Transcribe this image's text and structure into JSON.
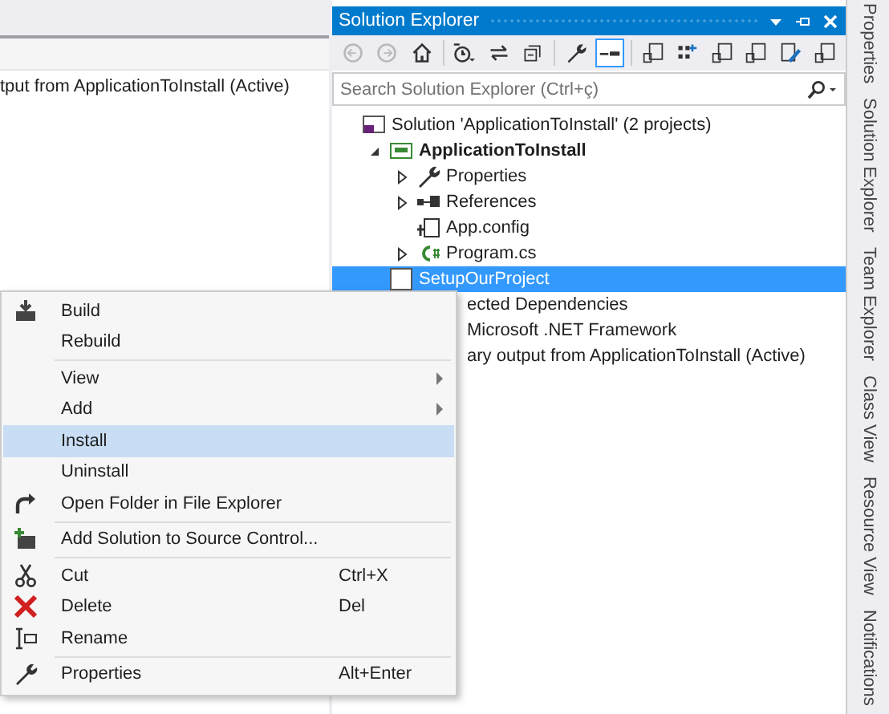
{
  "output_pane": {
    "line": "tput from ApplicationToInstall (Active)"
  },
  "solution_explorer": {
    "title": "Solution Explorer",
    "toolbar": [
      {
        "kind": "back",
        "disabled": true,
        "selected": false
      },
      {
        "kind": "forward",
        "disabled": true,
        "selected": false
      },
      {
        "kind": "home",
        "disabled": false,
        "selected": false
      },
      {
        "kind": "history",
        "disabled": false,
        "selected": false
      },
      {
        "kind": "sync",
        "disabled": false,
        "selected": false
      },
      {
        "kind": "collapse",
        "disabled": false,
        "selected": false
      },
      {
        "kind": "wrench",
        "disabled": false,
        "selected": false
      },
      {
        "kind": "pending",
        "disabled": false,
        "selected": true
      },
      {
        "kind": "file",
        "disabled": false,
        "selected": false
      },
      {
        "kind": "grid",
        "disabled": false,
        "selected": false
      },
      {
        "kind": "file",
        "disabled": false,
        "selected": false
      },
      {
        "kind": "file",
        "disabled": false,
        "selected": false
      },
      {
        "kind": "edit",
        "disabled": false,
        "selected": false
      },
      {
        "kind": "file",
        "disabled": false,
        "selected": false
      }
    ],
    "search": {
      "placeholder": "Search Solution Explorer (Ctrl+ç)"
    },
    "tree": [
      {
        "label": "Solution 'ApplicationToInstall' (2 projects)",
        "kind": "solution",
        "selected": false,
        "bold": false,
        "children": [
          {
            "label": "ApplicationToInstall",
            "kind": "csproj",
            "expanded": true,
            "selected": false,
            "bold": true,
            "children": [
              {
                "label": "Properties",
                "kind": "wrench",
                "expanded": false,
                "selected": false,
                "bold": false
              },
              {
                "label": "References",
                "kind": "references",
                "expanded": false,
                "selected": false,
                "bold": false
              },
              {
                "label": "App.config",
                "kind": "config",
                "selected": false,
                "bold": false
              },
              {
                "label": "Program.cs",
                "kind": "csfile",
                "expanded": false,
                "selected": false,
                "bold": false
              }
            ]
          },
          {
            "label": "SetupOurProject",
            "kind": "setup",
            "selected": true,
            "bold": false,
            "children": [
              {
                "label": "ected Dependencies",
                "covered": true,
                "selected": false,
                "bold": false
              },
              {
                "label": "Microsoft .NET Framework",
                "covered": true,
                "selected": false,
                "bold": false
              },
              {
                "label": "ary output from ApplicationToInstall (Active)",
                "covered": true,
                "selected": false,
                "bold": false
              }
            ]
          }
        ]
      }
    ]
  },
  "side_tabs": [
    "Properties",
    "Solution Explorer",
    "Team Explorer",
    "Class View",
    "Resource View",
    "Notifications"
  ],
  "context_menu": [
    {
      "kind": "build",
      "label": "Build",
      "selected": false
    },
    {
      "kind": "item",
      "label": "Rebuild",
      "selected": false
    },
    {
      "kind": "separator"
    },
    {
      "kind": "item",
      "label": "View",
      "submenu": true,
      "selected": false
    },
    {
      "kind": "item",
      "label": "Add",
      "submenu": true,
      "selected": false
    },
    {
      "kind": "item",
      "label": "Install",
      "selected": true
    },
    {
      "kind": "item",
      "label": "Uninstall",
      "selected": false
    },
    {
      "kind": "open",
      "label": "Open Folder in File Explorer",
      "selected": false
    },
    {
      "kind": "separator"
    },
    {
      "kind": "source",
      "label": "Add Solution to Source Control...",
      "selected": false
    },
    {
      "kind": "separator"
    },
    {
      "kind": "cut",
      "label": "Cut",
      "shortcut": "Ctrl+X",
      "selected": false
    },
    {
      "kind": "delete",
      "label": "Delete",
      "shortcut": "Del",
      "selected": false
    },
    {
      "kind": "rename",
      "label": "Rename",
      "selected": false
    },
    {
      "kind": "separator"
    },
    {
      "kind": "wrench",
      "label": "Properties",
      "shortcut": "Alt+Enter",
      "selected": false
    }
  ]
}
